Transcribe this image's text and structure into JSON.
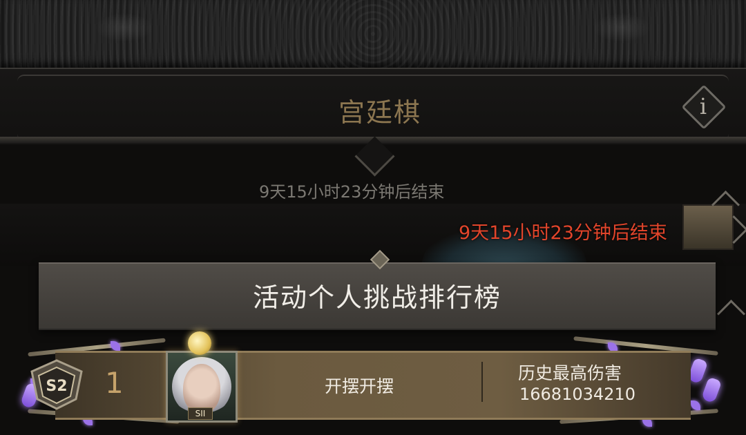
{
  "header": {
    "title": "宫廷棋",
    "info_icon": "info-icon",
    "info_glyph": "i"
  },
  "event": {
    "timer_gray": "9天15小时23分钟后结束",
    "timer_red": "9天15小时23分钟后结束"
  },
  "leaderboard": {
    "title": "活动个人挑战排行榜",
    "entries": [
      {
        "season_badge": "S2",
        "rank": "1",
        "avatar_badge": "SII",
        "player_name": "开摆开摆",
        "stat_label": "历史最高伤害",
        "stat_value": "16681034210"
      }
    ]
  },
  "colors": {
    "title": "#8c7650",
    "timer_red": "#e2452b",
    "rank_gold": "#c6a36b",
    "accent_purple": "#9b72e8"
  }
}
